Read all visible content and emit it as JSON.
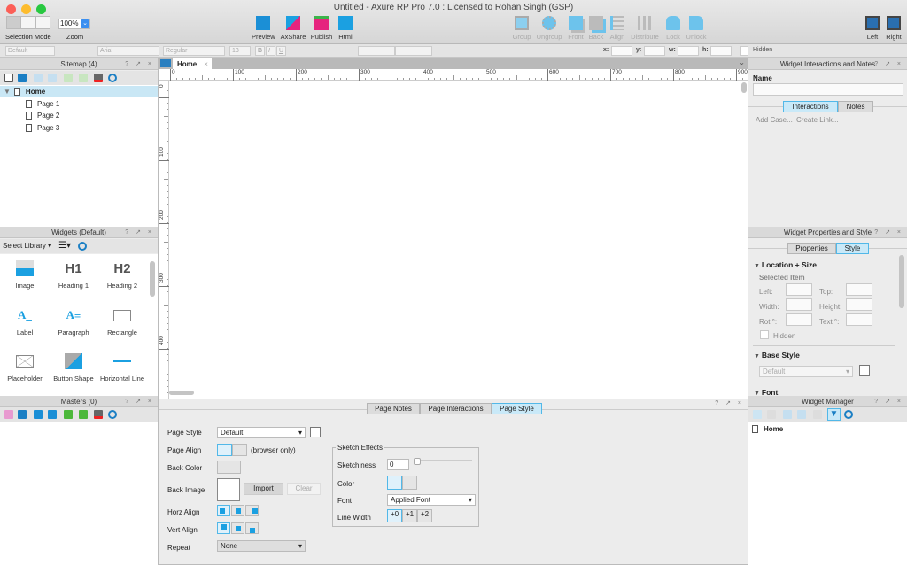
{
  "window": {
    "title": "Untitled - Axure RP Pro 7.0 : Licensed to Rohan Singh (GSP)"
  },
  "toolbar": {
    "selection_mode": "Selection Mode",
    "zoom_value": "100%",
    "zoom_label": "Zoom",
    "preview": "Preview",
    "axshare": "AxShare",
    "publish": "Publish",
    "html": "Html",
    "group": "Group",
    "ungroup": "Ungroup",
    "front": "Front",
    "back": "Back",
    "align": "Align",
    "distribute": "Distribute",
    "lock": "Lock",
    "unlock": "Unlock",
    "left": "Left",
    "right": "Right"
  },
  "format_bar": {
    "style": "Default",
    "font": "Arial",
    "weight": "Regular",
    "size": "13",
    "bold": "B",
    "italic": "I",
    "underline": "U",
    "x": "x:",
    "y": "y:",
    "w": "w:",
    "h": "h:",
    "hidden": "Hidden"
  },
  "sitemap": {
    "title": "Sitemap (4)",
    "pages": [
      {
        "label": "Home"
      },
      {
        "label": "Page 1"
      },
      {
        "label": "Page 2"
      },
      {
        "label": "Page 3"
      }
    ]
  },
  "widgets": {
    "title": "Widgets (Default)",
    "library": "Select Library",
    "items": [
      {
        "label": "Image"
      },
      {
        "label": "Heading 1",
        "glyph": "H1"
      },
      {
        "label": "Heading 2",
        "glyph": "H2"
      },
      {
        "label": "Label"
      },
      {
        "label": "Paragraph"
      },
      {
        "label": "Rectangle"
      },
      {
        "label": "Placeholder"
      },
      {
        "label": "Button Shape"
      },
      {
        "label": "Horizontal Line"
      }
    ]
  },
  "masters": {
    "title": "Masters (0)"
  },
  "canvas": {
    "tab": "Home",
    "ruler_h": [
      "0",
      "100",
      "200",
      "300",
      "400",
      "500",
      "600",
      "700",
      "800",
      "900"
    ],
    "ruler_v": [
      "0",
      "100",
      "200",
      "300",
      "400"
    ]
  },
  "page_props": {
    "tabs": [
      "Page Notes",
      "Page Interactions",
      "Page Style"
    ],
    "active_tab": "Page Style",
    "page_style_label": "Page Style",
    "page_style": "Default",
    "page_align_label": "Page Align",
    "browser_only": "(browser only)",
    "back_color_label": "Back Color",
    "back_image_label": "Back Image",
    "import": "Import",
    "clear": "Clear",
    "horz_align_label": "Horz Align",
    "vert_align_label": "Vert Align",
    "repeat_label": "Repeat",
    "repeat": "None",
    "sketch": {
      "title": "Sketch Effects",
      "sketchiness_label": "Sketchiness",
      "sketchiness": "0",
      "color_label": "Color",
      "font_label": "Font",
      "font": "Applied Font",
      "line_width_label": "Line Width",
      "line_widths": [
        "+0",
        "+1",
        "+2"
      ]
    }
  },
  "interactions": {
    "title": "Widget Interactions and Notes",
    "name_label": "Name",
    "tabs": [
      "Interactions",
      "Notes"
    ],
    "add_case": "Add Case...",
    "create_link": "Create Link..."
  },
  "properties": {
    "title": "Widget Properties and Style",
    "tabs": [
      "Properties",
      "Style"
    ],
    "location_size": "Location + Size",
    "selected_item": "Selected Item",
    "left": "Left:",
    "top": "Top:",
    "width": "Width:",
    "height": "Height:",
    "rot": "Rot °:",
    "text": "Text °:",
    "hidden": "Hidden",
    "base_style": "Base Style",
    "base_style_value": "Default",
    "font": "Font"
  },
  "widget_manager": {
    "title": "Widget Manager",
    "items": [
      "Home"
    ]
  },
  "panel_controls": "?  ↗  ×",
  "accent": "#1ba0e1"
}
